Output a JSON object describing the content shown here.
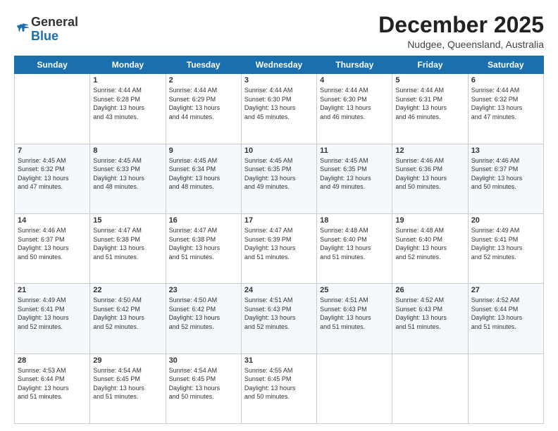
{
  "header": {
    "logo": {
      "line1": "General",
      "line2": "Blue"
    },
    "title": "December 2025",
    "location": "Nudgee, Queensland, Australia"
  },
  "weekdays": [
    "Sunday",
    "Monday",
    "Tuesday",
    "Wednesday",
    "Thursday",
    "Friday",
    "Saturday"
  ],
  "weeks": [
    [
      {
        "day": "",
        "info": ""
      },
      {
        "day": "1",
        "info": "Sunrise: 4:44 AM\nSunset: 6:28 PM\nDaylight: 13 hours\nand 43 minutes."
      },
      {
        "day": "2",
        "info": "Sunrise: 4:44 AM\nSunset: 6:29 PM\nDaylight: 13 hours\nand 44 minutes."
      },
      {
        "day": "3",
        "info": "Sunrise: 4:44 AM\nSunset: 6:30 PM\nDaylight: 13 hours\nand 45 minutes."
      },
      {
        "day": "4",
        "info": "Sunrise: 4:44 AM\nSunset: 6:30 PM\nDaylight: 13 hours\nand 46 minutes."
      },
      {
        "day": "5",
        "info": "Sunrise: 4:44 AM\nSunset: 6:31 PM\nDaylight: 13 hours\nand 46 minutes."
      },
      {
        "day": "6",
        "info": "Sunrise: 4:44 AM\nSunset: 6:32 PM\nDaylight: 13 hours\nand 47 minutes."
      }
    ],
    [
      {
        "day": "7",
        "info": "Sunrise: 4:45 AM\nSunset: 6:32 PM\nDaylight: 13 hours\nand 47 minutes."
      },
      {
        "day": "8",
        "info": "Sunrise: 4:45 AM\nSunset: 6:33 PM\nDaylight: 13 hours\nand 48 minutes."
      },
      {
        "day": "9",
        "info": "Sunrise: 4:45 AM\nSunset: 6:34 PM\nDaylight: 13 hours\nand 48 minutes."
      },
      {
        "day": "10",
        "info": "Sunrise: 4:45 AM\nSunset: 6:35 PM\nDaylight: 13 hours\nand 49 minutes."
      },
      {
        "day": "11",
        "info": "Sunrise: 4:45 AM\nSunset: 6:35 PM\nDaylight: 13 hours\nand 49 minutes."
      },
      {
        "day": "12",
        "info": "Sunrise: 4:46 AM\nSunset: 6:36 PM\nDaylight: 13 hours\nand 50 minutes."
      },
      {
        "day": "13",
        "info": "Sunrise: 4:46 AM\nSunset: 6:37 PM\nDaylight: 13 hours\nand 50 minutes."
      }
    ],
    [
      {
        "day": "14",
        "info": "Sunrise: 4:46 AM\nSunset: 6:37 PM\nDaylight: 13 hours\nand 50 minutes."
      },
      {
        "day": "15",
        "info": "Sunrise: 4:47 AM\nSunset: 6:38 PM\nDaylight: 13 hours\nand 51 minutes."
      },
      {
        "day": "16",
        "info": "Sunrise: 4:47 AM\nSunset: 6:38 PM\nDaylight: 13 hours\nand 51 minutes."
      },
      {
        "day": "17",
        "info": "Sunrise: 4:47 AM\nSunset: 6:39 PM\nDaylight: 13 hours\nand 51 minutes."
      },
      {
        "day": "18",
        "info": "Sunrise: 4:48 AM\nSunset: 6:40 PM\nDaylight: 13 hours\nand 51 minutes."
      },
      {
        "day": "19",
        "info": "Sunrise: 4:48 AM\nSunset: 6:40 PM\nDaylight: 13 hours\nand 52 minutes."
      },
      {
        "day": "20",
        "info": "Sunrise: 4:49 AM\nSunset: 6:41 PM\nDaylight: 13 hours\nand 52 minutes."
      }
    ],
    [
      {
        "day": "21",
        "info": "Sunrise: 4:49 AM\nSunset: 6:41 PM\nDaylight: 13 hours\nand 52 minutes."
      },
      {
        "day": "22",
        "info": "Sunrise: 4:50 AM\nSunset: 6:42 PM\nDaylight: 13 hours\nand 52 minutes."
      },
      {
        "day": "23",
        "info": "Sunrise: 4:50 AM\nSunset: 6:42 PM\nDaylight: 13 hours\nand 52 minutes."
      },
      {
        "day": "24",
        "info": "Sunrise: 4:51 AM\nSunset: 6:43 PM\nDaylight: 13 hours\nand 52 minutes."
      },
      {
        "day": "25",
        "info": "Sunrise: 4:51 AM\nSunset: 6:43 PM\nDaylight: 13 hours\nand 51 minutes."
      },
      {
        "day": "26",
        "info": "Sunrise: 4:52 AM\nSunset: 6:43 PM\nDaylight: 13 hours\nand 51 minutes."
      },
      {
        "day": "27",
        "info": "Sunrise: 4:52 AM\nSunset: 6:44 PM\nDaylight: 13 hours\nand 51 minutes."
      }
    ],
    [
      {
        "day": "28",
        "info": "Sunrise: 4:53 AM\nSunset: 6:44 PM\nDaylight: 13 hours\nand 51 minutes."
      },
      {
        "day": "29",
        "info": "Sunrise: 4:54 AM\nSunset: 6:45 PM\nDaylight: 13 hours\nand 51 minutes."
      },
      {
        "day": "30",
        "info": "Sunrise: 4:54 AM\nSunset: 6:45 PM\nDaylight: 13 hours\nand 50 minutes."
      },
      {
        "day": "31",
        "info": "Sunrise: 4:55 AM\nSunset: 6:45 PM\nDaylight: 13 hours\nand 50 minutes."
      },
      {
        "day": "",
        "info": ""
      },
      {
        "day": "",
        "info": ""
      },
      {
        "day": "",
        "info": ""
      }
    ]
  ]
}
